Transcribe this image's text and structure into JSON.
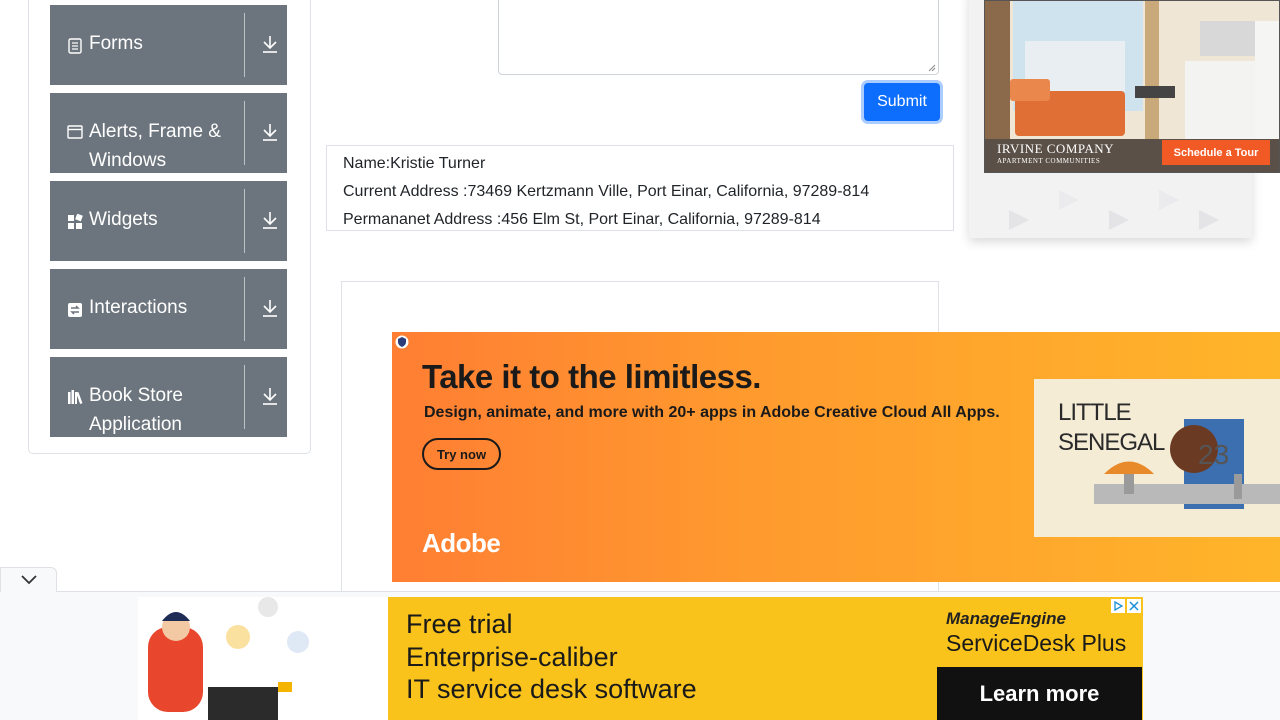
{
  "sidebar": {
    "groups": [
      {
        "label": "Forms",
        "icon": "form-icon"
      },
      {
        "label": "Alerts, Frame & Windows",
        "icon": "window-icon"
      },
      {
        "label": "Widgets",
        "icon": "widgets-icon"
      },
      {
        "label": "Interactions",
        "icon": "interactions-icon"
      },
      {
        "label": "Book Store Application",
        "icon": "books-icon"
      }
    ],
    "download_icon": "download-icon"
  },
  "form": {
    "submit_label": "Submit"
  },
  "output": {
    "name": "Name:Kristie Turner",
    "current_address": "Current Address :73469 Kertzmann Ville, Port Einar, California, 97289-814",
    "permanent_address": "Permananet Address :456 Elm St, Port Einar, California, 97289-814"
  },
  "ads": {
    "apartment": {
      "brand": "IRVINE COMPANY",
      "brand_sub": "APARTMENT COMMUNITIES",
      "cta": "Schedule a Tour"
    },
    "adobe": {
      "headline": "Take it to the limitless.",
      "sub": "Design, animate, and more with 20+ apps in Adobe Creative Cloud All Apps.",
      "cta": "Try now",
      "logo": "Adobe",
      "art_title_1": "LITTLE",
      "art_title_2": "SENEGAL",
      "art_number": "23"
    },
    "manageengine": {
      "line1": "Free trial",
      "line2": "Enterprise-caliber",
      "line3": "IT service desk software",
      "brand1": "ManageEngine",
      "brand2": "ServiceDesk Plus",
      "cta": "Learn more"
    }
  },
  "colors": {
    "sidebar_header": "#6c757d",
    "submit": "#0d6efd",
    "adobe_orange": "#ff8a30",
    "me_yellow": "#f9c31b"
  }
}
